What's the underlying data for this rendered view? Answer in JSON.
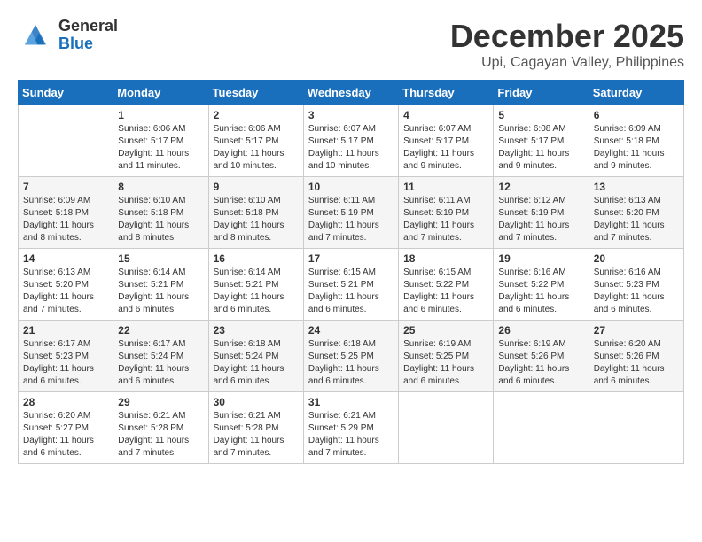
{
  "header": {
    "logo_general": "General",
    "logo_blue": "Blue",
    "month_title": "December 2025",
    "location": "Upi, Cagayan Valley, Philippines"
  },
  "weekdays": [
    "Sunday",
    "Monday",
    "Tuesday",
    "Wednesday",
    "Thursday",
    "Friday",
    "Saturday"
  ],
  "weeks": [
    [
      {
        "day": "",
        "sunrise": "",
        "sunset": "",
        "daylight": ""
      },
      {
        "day": "1",
        "sunrise": "Sunrise: 6:06 AM",
        "sunset": "Sunset: 5:17 PM",
        "daylight": "Daylight: 11 hours and 11 minutes."
      },
      {
        "day": "2",
        "sunrise": "Sunrise: 6:06 AM",
        "sunset": "Sunset: 5:17 PM",
        "daylight": "Daylight: 11 hours and 10 minutes."
      },
      {
        "day": "3",
        "sunrise": "Sunrise: 6:07 AM",
        "sunset": "Sunset: 5:17 PM",
        "daylight": "Daylight: 11 hours and 10 minutes."
      },
      {
        "day": "4",
        "sunrise": "Sunrise: 6:07 AM",
        "sunset": "Sunset: 5:17 PM",
        "daylight": "Daylight: 11 hours and 9 minutes."
      },
      {
        "day": "5",
        "sunrise": "Sunrise: 6:08 AM",
        "sunset": "Sunset: 5:17 PM",
        "daylight": "Daylight: 11 hours and 9 minutes."
      },
      {
        "day": "6",
        "sunrise": "Sunrise: 6:09 AM",
        "sunset": "Sunset: 5:18 PM",
        "daylight": "Daylight: 11 hours and 9 minutes."
      }
    ],
    [
      {
        "day": "7",
        "sunrise": "Sunrise: 6:09 AM",
        "sunset": "Sunset: 5:18 PM",
        "daylight": "Daylight: 11 hours and 8 minutes."
      },
      {
        "day": "8",
        "sunrise": "Sunrise: 6:10 AM",
        "sunset": "Sunset: 5:18 PM",
        "daylight": "Daylight: 11 hours and 8 minutes."
      },
      {
        "day": "9",
        "sunrise": "Sunrise: 6:10 AM",
        "sunset": "Sunset: 5:18 PM",
        "daylight": "Daylight: 11 hours and 8 minutes."
      },
      {
        "day": "10",
        "sunrise": "Sunrise: 6:11 AM",
        "sunset": "Sunset: 5:19 PM",
        "daylight": "Daylight: 11 hours and 7 minutes."
      },
      {
        "day": "11",
        "sunrise": "Sunrise: 6:11 AM",
        "sunset": "Sunset: 5:19 PM",
        "daylight": "Daylight: 11 hours and 7 minutes."
      },
      {
        "day": "12",
        "sunrise": "Sunrise: 6:12 AM",
        "sunset": "Sunset: 5:19 PM",
        "daylight": "Daylight: 11 hours and 7 minutes."
      },
      {
        "day": "13",
        "sunrise": "Sunrise: 6:13 AM",
        "sunset": "Sunset: 5:20 PM",
        "daylight": "Daylight: 11 hours and 7 minutes."
      }
    ],
    [
      {
        "day": "14",
        "sunrise": "Sunrise: 6:13 AM",
        "sunset": "Sunset: 5:20 PM",
        "daylight": "Daylight: 11 hours and 7 minutes."
      },
      {
        "day": "15",
        "sunrise": "Sunrise: 6:14 AM",
        "sunset": "Sunset: 5:21 PM",
        "daylight": "Daylight: 11 hours and 6 minutes."
      },
      {
        "day": "16",
        "sunrise": "Sunrise: 6:14 AM",
        "sunset": "Sunset: 5:21 PM",
        "daylight": "Daylight: 11 hours and 6 minutes."
      },
      {
        "day": "17",
        "sunrise": "Sunrise: 6:15 AM",
        "sunset": "Sunset: 5:21 PM",
        "daylight": "Daylight: 11 hours and 6 minutes."
      },
      {
        "day": "18",
        "sunrise": "Sunrise: 6:15 AM",
        "sunset": "Sunset: 5:22 PM",
        "daylight": "Daylight: 11 hours and 6 minutes."
      },
      {
        "day": "19",
        "sunrise": "Sunrise: 6:16 AM",
        "sunset": "Sunset: 5:22 PM",
        "daylight": "Daylight: 11 hours and 6 minutes."
      },
      {
        "day": "20",
        "sunrise": "Sunrise: 6:16 AM",
        "sunset": "Sunset: 5:23 PM",
        "daylight": "Daylight: 11 hours and 6 minutes."
      }
    ],
    [
      {
        "day": "21",
        "sunrise": "Sunrise: 6:17 AM",
        "sunset": "Sunset: 5:23 PM",
        "daylight": "Daylight: 11 hours and 6 minutes."
      },
      {
        "day": "22",
        "sunrise": "Sunrise: 6:17 AM",
        "sunset": "Sunset: 5:24 PM",
        "daylight": "Daylight: 11 hours and 6 minutes."
      },
      {
        "day": "23",
        "sunrise": "Sunrise: 6:18 AM",
        "sunset": "Sunset: 5:24 PM",
        "daylight": "Daylight: 11 hours and 6 minutes."
      },
      {
        "day": "24",
        "sunrise": "Sunrise: 6:18 AM",
        "sunset": "Sunset: 5:25 PM",
        "daylight": "Daylight: 11 hours and 6 minutes."
      },
      {
        "day": "25",
        "sunrise": "Sunrise: 6:19 AM",
        "sunset": "Sunset: 5:25 PM",
        "daylight": "Daylight: 11 hours and 6 minutes."
      },
      {
        "day": "26",
        "sunrise": "Sunrise: 6:19 AM",
        "sunset": "Sunset: 5:26 PM",
        "daylight": "Daylight: 11 hours and 6 minutes."
      },
      {
        "day": "27",
        "sunrise": "Sunrise: 6:20 AM",
        "sunset": "Sunset: 5:26 PM",
        "daylight": "Daylight: 11 hours and 6 minutes."
      }
    ],
    [
      {
        "day": "28",
        "sunrise": "Sunrise: 6:20 AM",
        "sunset": "Sunset: 5:27 PM",
        "daylight": "Daylight: 11 hours and 6 minutes."
      },
      {
        "day": "29",
        "sunrise": "Sunrise: 6:21 AM",
        "sunset": "Sunset: 5:28 PM",
        "daylight": "Daylight: 11 hours and 7 minutes."
      },
      {
        "day": "30",
        "sunrise": "Sunrise: 6:21 AM",
        "sunset": "Sunset: 5:28 PM",
        "daylight": "Daylight: 11 hours and 7 minutes."
      },
      {
        "day": "31",
        "sunrise": "Sunrise: 6:21 AM",
        "sunset": "Sunset: 5:29 PM",
        "daylight": "Daylight: 11 hours and 7 minutes."
      },
      {
        "day": "",
        "sunrise": "",
        "sunset": "",
        "daylight": ""
      },
      {
        "day": "",
        "sunrise": "",
        "sunset": "",
        "daylight": ""
      },
      {
        "day": "",
        "sunrise": "",
        "sunset": "",
        "daylight": ""
      }
    ]
  ]
}
